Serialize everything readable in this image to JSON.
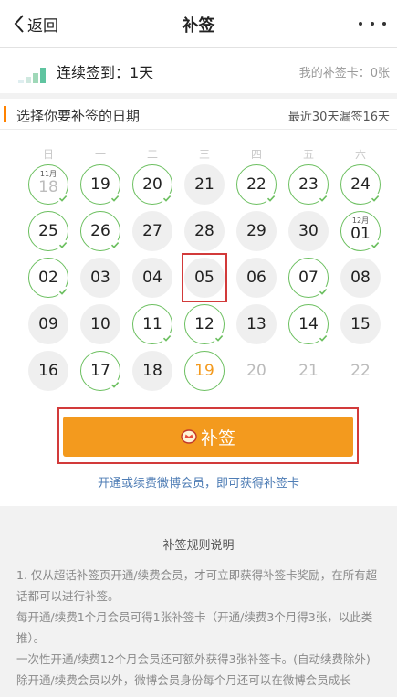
{
  "nav": {
    "back_label": "返回",
    "title": "补签",
    "more_icon": "more-dots-icon"
  },
  "streak": {
    "label": "连续签到：1天",
    "card_label": "我的补签卡：0张"
  },
  "section": {
    "title": "选择你要补签的日期",
    "stat": "最近30天漏签16天"
  },
  "weekdays": [
    "日",
    "一",
    "二",
    "三",
    "四",
    "五",
    "六"
  ],
  "calendar": {
    "days": [
      {
        "num": "18",
        "state": "signed",
        "month": "11月"
      },
      {
        "num": "19",
        "state": "signed"
      },
      {
        "num": "20",
        "state": "signed"
      },
      {
        "num": "21",
        "state": "plain"
      },
      {
        "num": "22",
        "state": "signed"
      },
      {
        "num": "23",
        "state": "signed"
      },
      {
        "num": "24",
        "state": "signed"
      },
      {
        "num": "25",
        "state": "signed"
      },
      {
        "num": "26",
        "state": "signed"
      },
      {
        "num": "27",
        "state": "plain"
      },
      {
        "num": "28",
        "state": "plain"
      },
      {
        "num": "29",
        "state": "plain"
      },
      {
        "num": "30",
        "state": "plain"
      },
      {
        "num": "01",
        "state": "signed",
        "month": "12月"
      },
      {
        "num": "02",
        "state": "signed"
      },
      {
        "num": "03",
        "state": "plain"
      },
      {
        "num": "04",
        "state": "plain"
      },
      {
        "num": "05",
        "state": "plain",
        "selected": true
      },
      {
        "num": "06",
        "state": "plain"
      },
      {
        "num": "07",
        "state": "signed"
      },
      {
        "num": "08",
        "state": "plain"
      },
      {
        "num": "09",
        "state": "plain"
      },
      {
        "num": "10",
        "state": "plain"
      },
      {
        "num": "11",
        "state": "signed"
      },
      {
        "num": "12",
        "state": "signed"
      },
      {
        "num": "13",
        "state": "plain"
      },
      {
        "num": "14",
        "state": "signed"
      },
      {
        "num": "15",
        "state": "plain"
      },
      {
        "num": "16",
        "state": "plain"
      },
      {
        "num": "17",
        "state": "signed"
      },
      {
        "num": "18",
        "state": "plain"
      },
      {
        "num": "19",
        "state": "today"
      },
      {
        "num": "20",
        "state": "future"
      },
      {
        "num": "21",
        "state": "future"
      },
      {
        "num": "22",
        "state": "future"
      }
    ]
  },
  "button": {
    "label": "补签",
    "icon": "vip-crown-icon"
  },
  "vip_link": "开通或续费微博会员，即可获得补签卡",
  "rules": {
    "title": "补签规则说明",
    "lines": [
      "1. 仅从超话补签页开通/续费会员，才可立即获得补签卡奖励，在所有超话都可以进行补签。",
      "每开通/续费1个月会员可得1张补签卡（开通/续费3个月得3张，以此类推）。",
      "一次性开通/续费12个月会员还可额外获得3张补签卡。(自动续费除外)",
      "除开通/续费会员以外，微博会员身份每个月还可以在微博会员成长"
    ]
  },
  "colors": {
    "accent": "#f39a1e",
    "signed": "#6bbf5f",
    "link": "#4f7db5",
    "highlight": "#d23a3a"
  }
}
